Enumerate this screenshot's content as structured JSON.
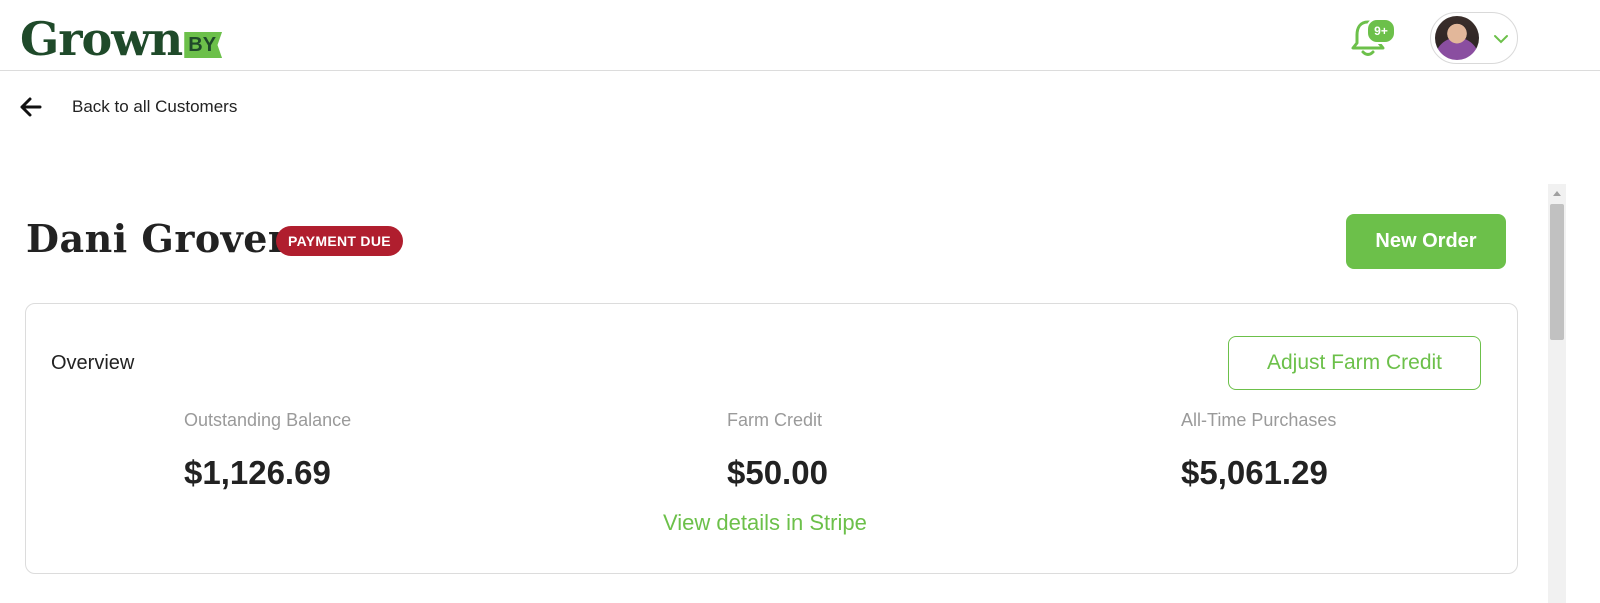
{
  "header": {
    "logo_text": "Grown",
    "logo_suffix": "BY",
    "notification_count": "9+",
    "user_menu_icon": "chevron-down-icon"
  },
  "nav": {
    "back_label": "Back to all Customers"
  },
  "customer": {
    "name": "Dani Grover",
    "status_badge": "PAYMENT DUE",
    "new_order_label": "New Order"
  },
  "overview": {
    "title": "Overview",
    "adjust_label": "Adjust Farm Credit",
    "stats": [
      {
        "label": "Outstanding Balance",
        "value": "$1,126.69"
      },
      {
        "label": "Farm Credit",
        "value": "$50.00"
      },
      {
        "label": "All-Time Purchases",
        "value": "$5,061.29"
      }
    ],
    "stripe_link": "View details in Stripe"
  },
  "colors": {
    "brand_green": "#6cc04a",
    "logo_dark": "#1f4a2a",
    "badge_red": "#b01e2e"
  }
}
